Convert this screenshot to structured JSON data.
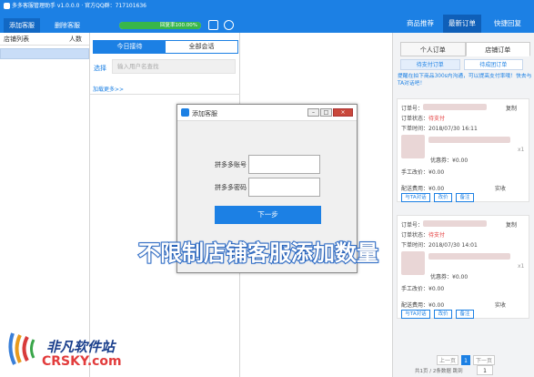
{
  "app": {
    "title": "多多客服管理助手 v1.0.0.0 · 官方QQ群：717101636"
  },
  "toolbar": {
    "add_service": "添加客服",
    "delete_service": "删除客服",
    "reply_rate_label": "回复率100.00%",
    "reply_rate": 1.0
  },
  "right_nav": {
    "tabs": [
      "商品推荐",
      "最新订单",
      "快捷回复"
    ],
    "active": 1
  },
  "left_panel": {
    "col_shop": "店铺列表",
    "col_people": "人数"
  },
  "chat_tabs": {
    "today": "今日接待",
    "all": "全部会话"
  },
  "chat_search": {
    "label": "选择",
    "placeholder": "输入用户名查找"
  },
  "chat_load_more": "加载更多>>",
  "orders": {
    "tabs": [
      "个人订单",
      "店铺订单"
    ],
    "subtabs": [
      "待支付订单",
      "待成团订单"
    ],
    "tip": "提醒在拍下商品300s内沟通，可以提高支付率哦！快去与TA对话吧！",
    "cards": [
      {
        "order_no_label": "订单号：",
        "copy": "复制",
        "status_label": "订单状态：",
        "status": "待支付",
        "time_label": "下单时间：",
        "time": "2018/07/30 16:11",
        "qty": "x1",
        "discount_label": "优惠券：",
        "discount": "¥0.00",
        "price_change_label": "手工改价：",
        "price_change": "¥0.00",
        "shipping_label": "配送费用：",
        "shipping": "¥0.00",
        "actual_label": "实收",
        "actions": [
          "与TA对话",
          "改价",
          "备注"
        ]
      },
      {
        "order_no_label": "订单号：",
        "copy": "复制",
        "status_label": "订单状态：",
        "status": "待支付",
        "time_label": "下单时间：",
        "time": "2018/07/30 14:01",
        "qty": "x1",
        "discount_label": "优惠券：",
        "discount": "¥0.00",
        "price_change_label": "手工改价：",
        "price_change": "¥0.00",
        "shipping_label": "配送费用：",
        "shipping": "¥0.00",
        "actual_label": "实收",
        "actions": [
          "与TA对话",
          "改价",
          "备注"
        ]
      }
    ],
    "pager": {
      "prev": "上一页",
      "current": "1",
      "next": "下一页",
      "summary": "共1页 / 2条数据 跳到",
      "jump_value": "1"
    }
  },
  "dialog": {
    "title": "添加客服",
    "account_label": "拼多多账号",
    "password_label": "拼多多密码",
    "next_button": "下一步"
  },
  "overlay_caption": "不限制店铺客服添加数量",
  "watermark": {
    "text": "非凡软件站",
    "sub_left": "CRSKY",
    "sub_right": ".com"
  },
  "colors": {
    "primary": "#1c80e4",
    "success": "#38b64a",
    "danger": "#e43d3d"
  }
}
